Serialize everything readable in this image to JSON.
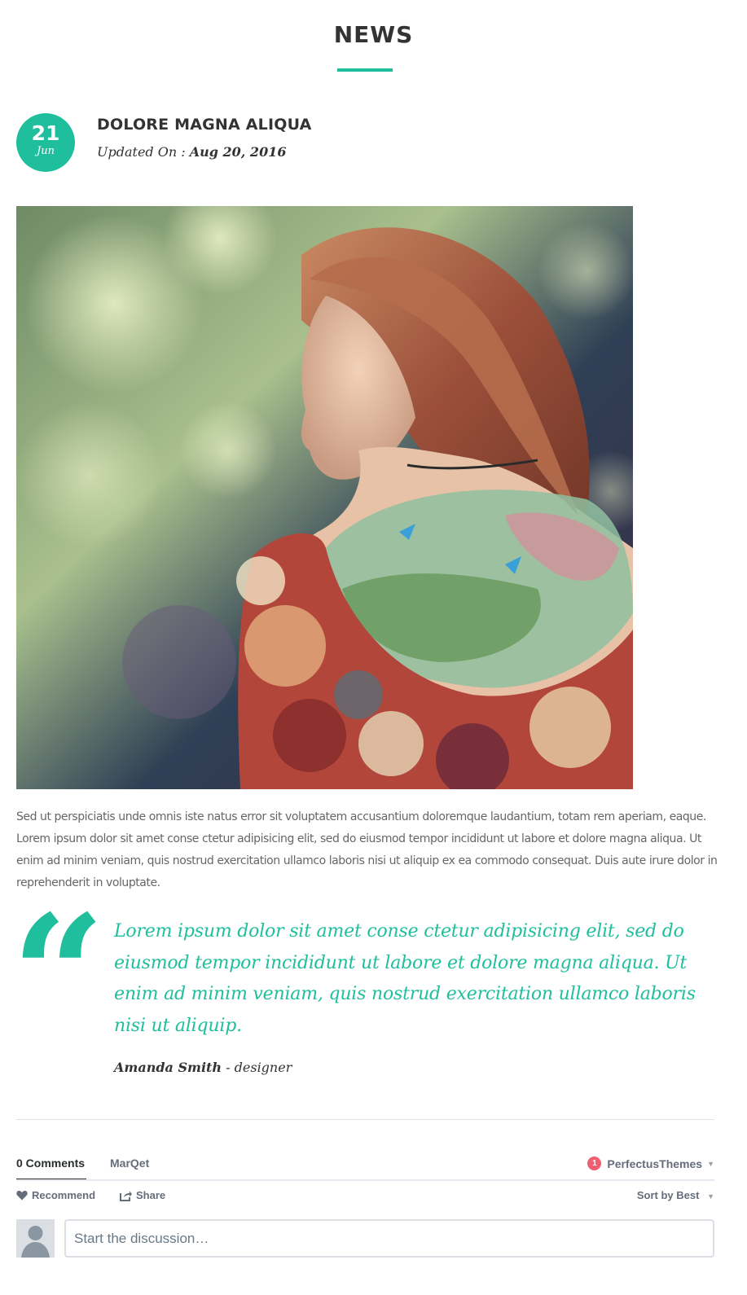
{
  "section": {
    "title": "NEWS"
  },
  "post": {
    "date_day": "21",
    "date_month": "Jun",
    "title": "DOLORE MAGNA ALIQUA",
    "updated_prefix": "Updated On : ",
    "updated_date": "Aug 20, 2016",
    "body": "Sed ut perspiciatis unde omnis iste natus error sit voluptatem accusantium doloremque laudantium, totam rem aperiam, eaque. Lorem ipsum dolor sit amet conse ctetur adipisicing elit, sed do eiusmod tempor incididunt ut labore et dolore magna aliqua. Ut enim ad minim veniam, quis nostrud exercitation ullamco laboris nisi ut aliquip ex ea commodo consequat. Duis aute irure dolor in reprehenderit in voluptate."
  },
  "quote": {
    "mark": "“",
    "text": "Lorem ipsum dolor sit amet conse ctetur adipisicing elit, sed do eiusmod tempor incididunt ut labore et dolore magna aliqua. Ut enim ad minim veniam, quis nostrud exercitation ullamco laboris nisi ut aliquip.",
    "author_name": "Amanda Smith",
    "author_role": " - designer"
  },
  "comments": {
    "tab_comments": "0 Comments",
    "tab_community": "MarQet",
    "notification_count": "1",
    "user_name": "PerfectusThemes",
    "recommend_label": "Recommend",
    "share_label": "Share",
    "sort_label": "Sort by Best",
    "input_placeholder": "Start the discussion…"
  },
  "colors": {
    "accent": "#1fbf9d",
    "heading": "#333333",
    "notification": "#f05f70"
  },
  "icons": {
    "caret": "▼"
  }
}
